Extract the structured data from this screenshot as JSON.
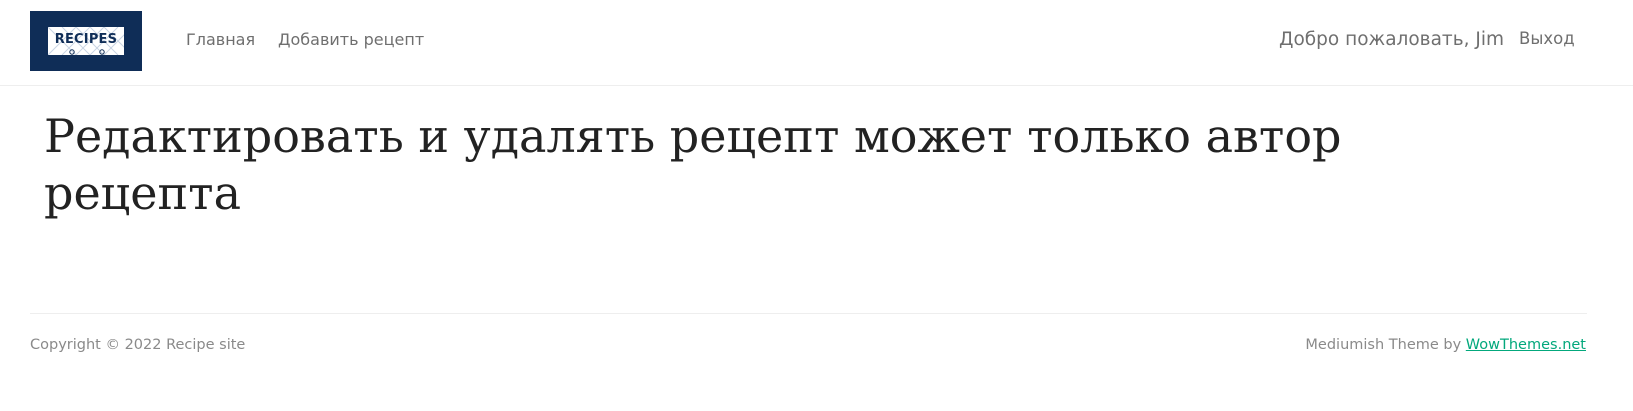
{
  "header": {
    "logo_text": "RECIPES",
    "nav": {
      "home": "Главная",
      "add_recipe": "Добавить рецепт"
    },
    "welcome": "Добро пожаловать, Jim",
    "logout": "Выход"
  },
  "main": {
    "message": "Редактировать и удалять рецепт может только автор рецепта"
  },
  "footer": {
    "copyright": "Copyright © 2022 Recipe site",
    "theme_prefix": "Mediumish Theme by",
    "theme_link": "WowThemes.net"
  },
  "colors": {
    "logo_bg": "#0f2d57",
    "link_accent": "#03a87c",
    "nav_text": "#6f6f6f",
    "title_text": "#222222"
  }
}
